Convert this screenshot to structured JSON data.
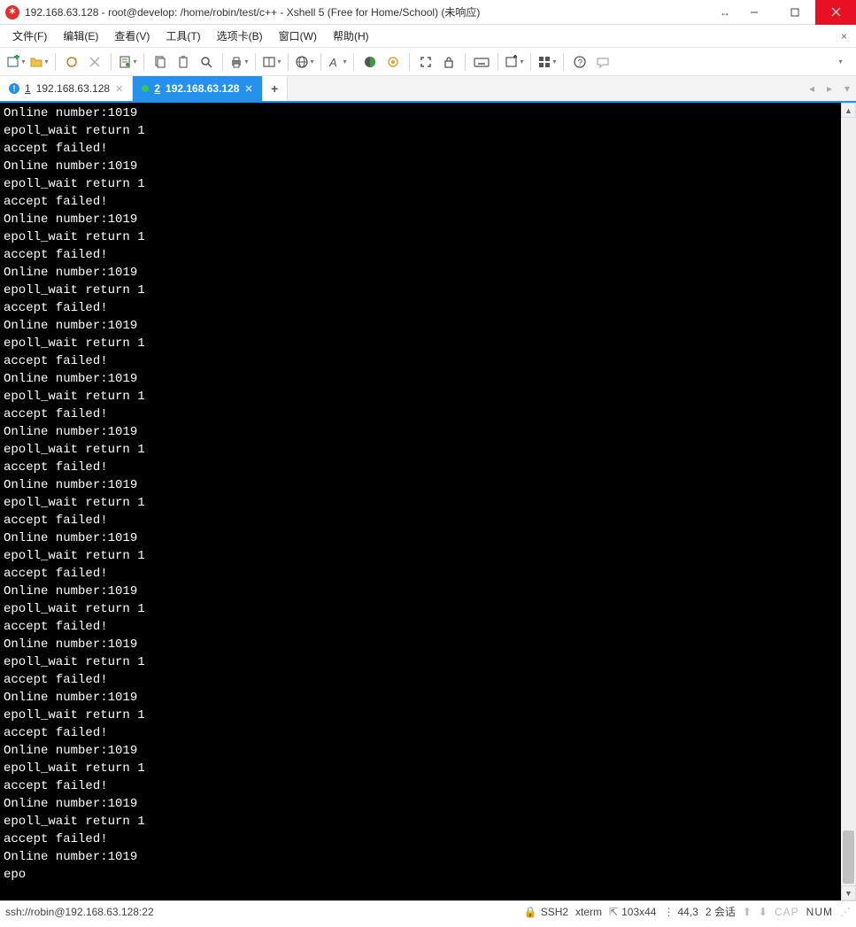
{
  "window": {
    "title": "192.168.63.128 - root@develop: /home/robin/test/c++ - Xshell 5 (Free for Home/School) (未响应)"
  },
  "menu": {
    "items": [
      "文件(F)",
      "编辑(E)",
      "查看(V)",
      "工具(T)",
      "选项卡(B)",
      "窗口(W)",
      "帮助(H)"
    ]
  },
  "tabs": {
    "inactive": {
      "index": "1",
      "label": "192.168.63.128"
    },
    "active": {
      "index": "2",
      "label": "192.168.63.128"
    }
  },
  "terminal": {
    "lines": [
      "Online number:1019",
      "epoll_wait return 1",
      "accept failed!",
      "Online number:1019",
      "epoll_wait return 1",
      "accept failed!",
      "Online number:1019",
      "epoll_wait return 1",
      "accept failed!",
      "Online number:1019",
      "epoll_wait return 1",
      "accept failed!",
      "Online number:1019",
      "epoll_wait return 1",
      "accept failed!",
      "Online number:1019",
      "epoll_wait return 1",
      "accept failed!",
      "Online number:1019",
      "epoll_wait return 1",
      "accept failed!",
      "Online number:1019",
      "epoll_wait return 1",
      "accept failed!",
      "Online number:1019",
      "epoll_wait return 1",
      "accept failed!",
      "Online number:1019",
      "epoll_wait return 1",
      "accept failed!",
      "Online number:1019",
      "epoll_wait return 1",
      "accept failed!",
      "Online number:1019",
      "epoll_wait return 1",
      "accept failed!",
      "Online number:1019",
      "epoll_wait return 1",
      "accept failed!",
      "Online number:1019",
      "epoll_wait return 1",
      "accept failed!",
      "Online number:1019",
      "epo"
    ]
  },
  "status": {
    "left": "ssh://robin@192.168.63.128:22",
    "ssh": "SSH2",
    "term": "xterm",
    "size": "103x44",
    "cursor": "44,3",
    "sessions": "2 会话",
    "cap": "CAP",
    "num": "NUM"
  }
}
